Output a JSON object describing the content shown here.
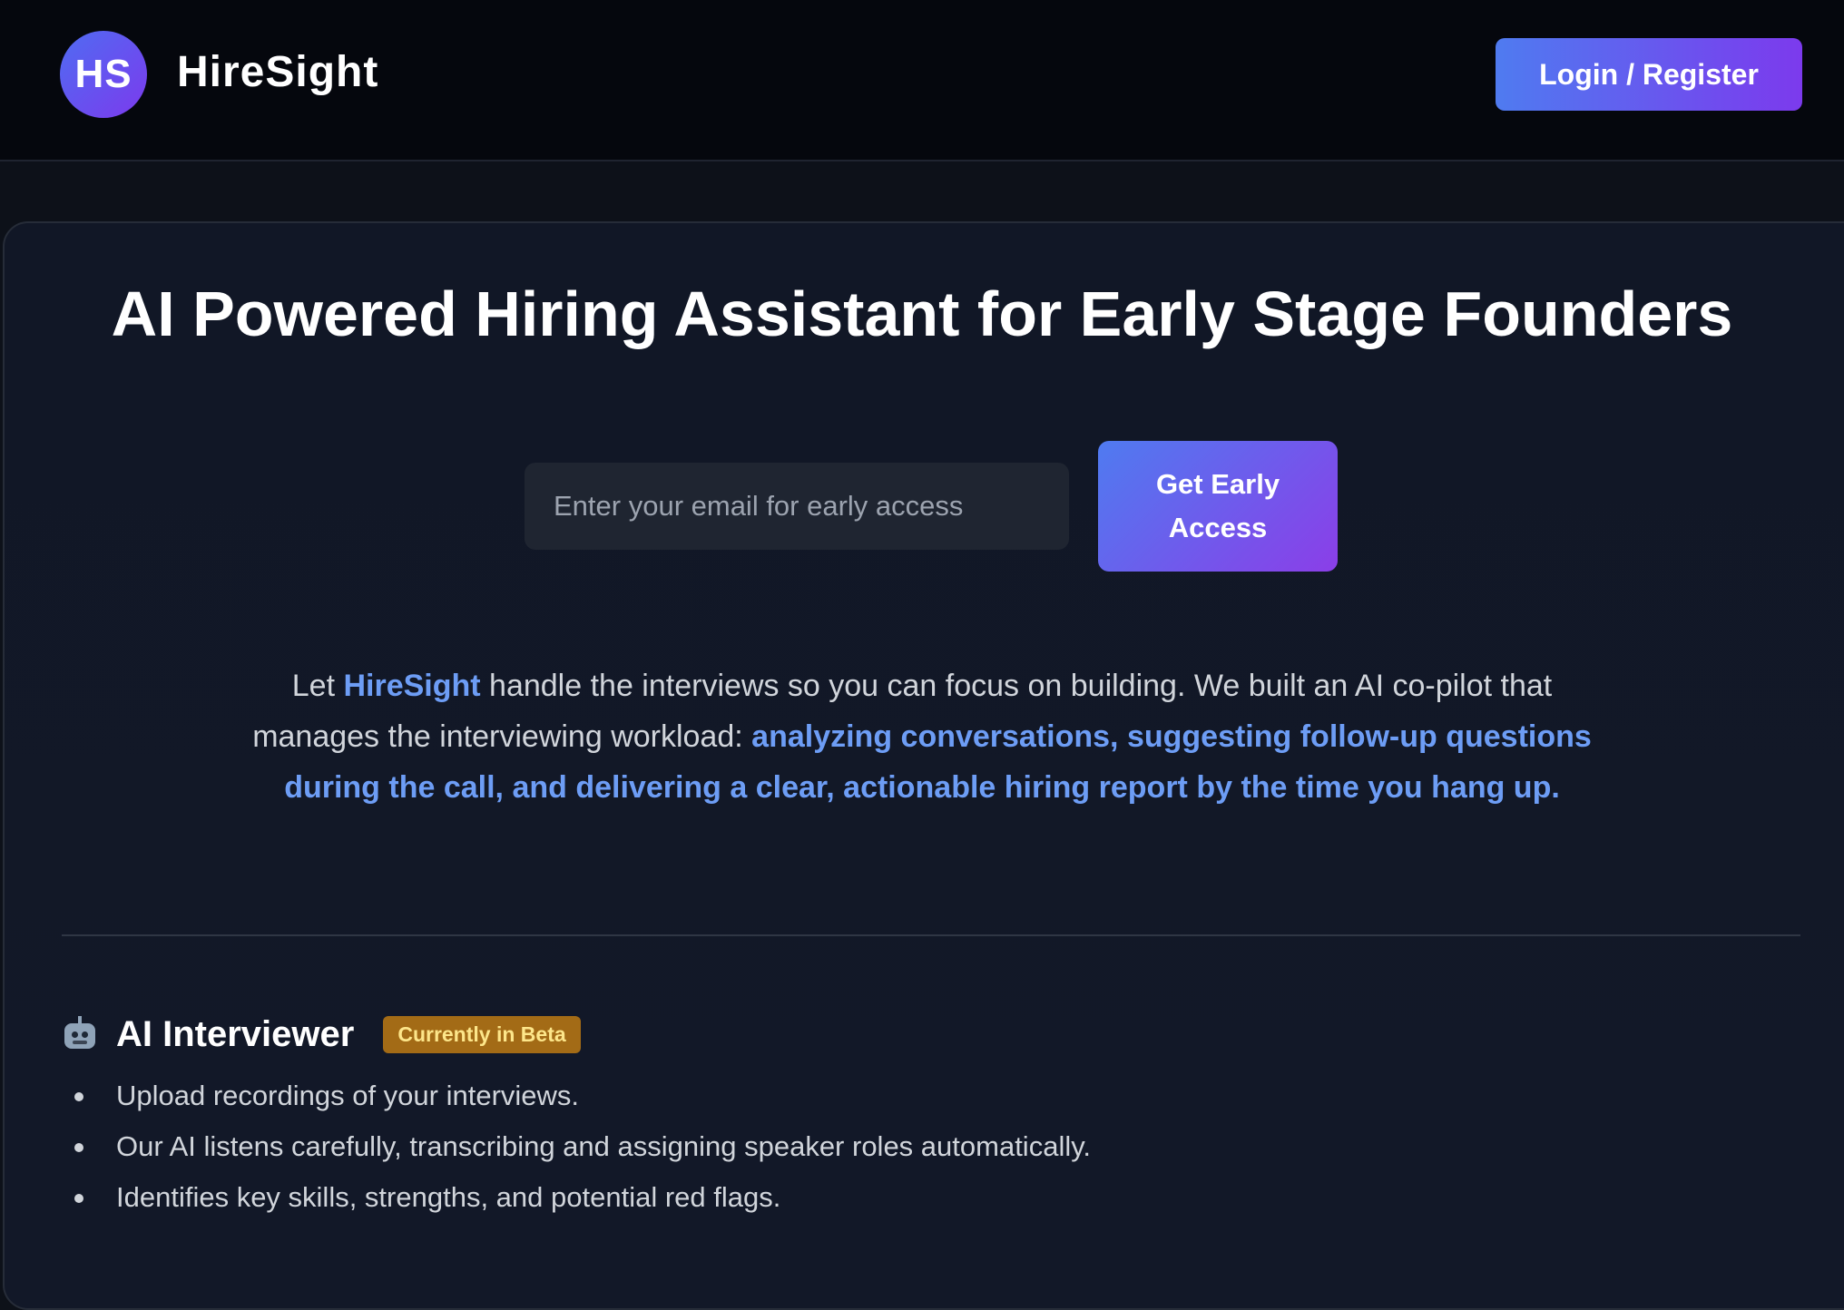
{
  "header": {
    "logo_initials": "HS",
    "brand_name": "HireSight",
    "login_label": "Login / Register"
  },
  "hero": {
    "headline": "AI Powered Hiring Assistant for Early Stage Founders",
    "email_placeholder": "Enter your email for early access",
    "cta_label": "Get Early Access"
  },
  "intro": {
    "prefix": "Let ",
    "brand": "HireSight",
    "middle": " handle the interviews so you can focus on building. We built an AI co-pilot that manages the interviewing workload: ",
    "highlight": "analyzing conversations, suggesting follow-up questions during the call, and delivering a clear, actionable hiring report by the time you hang up."
  },
  "feature": {
    "icon": "robot-icon",
    "title": "AI Interviewer",
    "badge": "Currently in Beta",
    "items": [
      "Upload recordings of your interviews.",
      "Our AI listens carefully, transcribing and assigning speaker roles automatically.",
      "Identifies key skills, strengths, and potential red flags."
    ]
  },
  "colors": {
    "accent_start": "#4f7bf0",
    "accent_end": "#7c3aed",
    "highlight_text": "#6d9df5",
    "badge_bg": "#a36b16",
    "background": "#0d1119"
  }
}
